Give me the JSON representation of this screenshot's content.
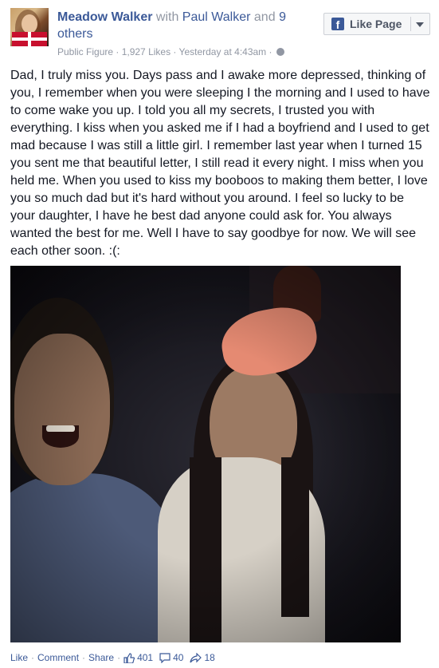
{
  "header": {
    "author": "Meadow Walker",
    "with_text": "with",
    "tagged": "Paul Walker",
    "and_text": "and",
    "others": "9 others",
    "page_type": "Public Figure",
    "likes_count": "1,927 Likes",
    "timestamp": "Yesterday at 4:43am",
    "like_page_button": "Like Page"
  },
  "post": {
    "text": "Dad, I truly miss you. Days pass and I awake more depressed, thinking of you, I remember when you were sleeping I the morning and I used to have to come wake you up. I told you all my secrets, I trusted you with everything. I kiss when you asked me if I had a boyfriend and I used to get mad because I was still a little girl. I remember last year when I turned 15 you sent me that beautiful letter, I still read it every night. I miss when you held me. When you used to kiss my booboos to making them better, I love you so much dad but it's hard without you around. I feel so lucky to be your daughter, I have he best dad anyone could ask for. You always wanted the best for me. Well I have to say goodbye for now. We will see each other soon. :(:"
  },
  "footer": {
    "like": "Like",
    "comment": "Comment",
    "share": "Share",
    "likes": "401",
    "comments": "40",
    "shares": "18"
  },
  "icons": {
    "globe": "globe-icon",
    "thumb": "thumbs-up-icon",
    "comment": "comment-bubble-icon",
    "share": "share-arrow-icon",
    "facebook": "facebook-f-icon"
  },
  "colors": {
    "link": "#3b5998",
    "muted": "#9197a3",
    "text": "#141823"
  }
}
